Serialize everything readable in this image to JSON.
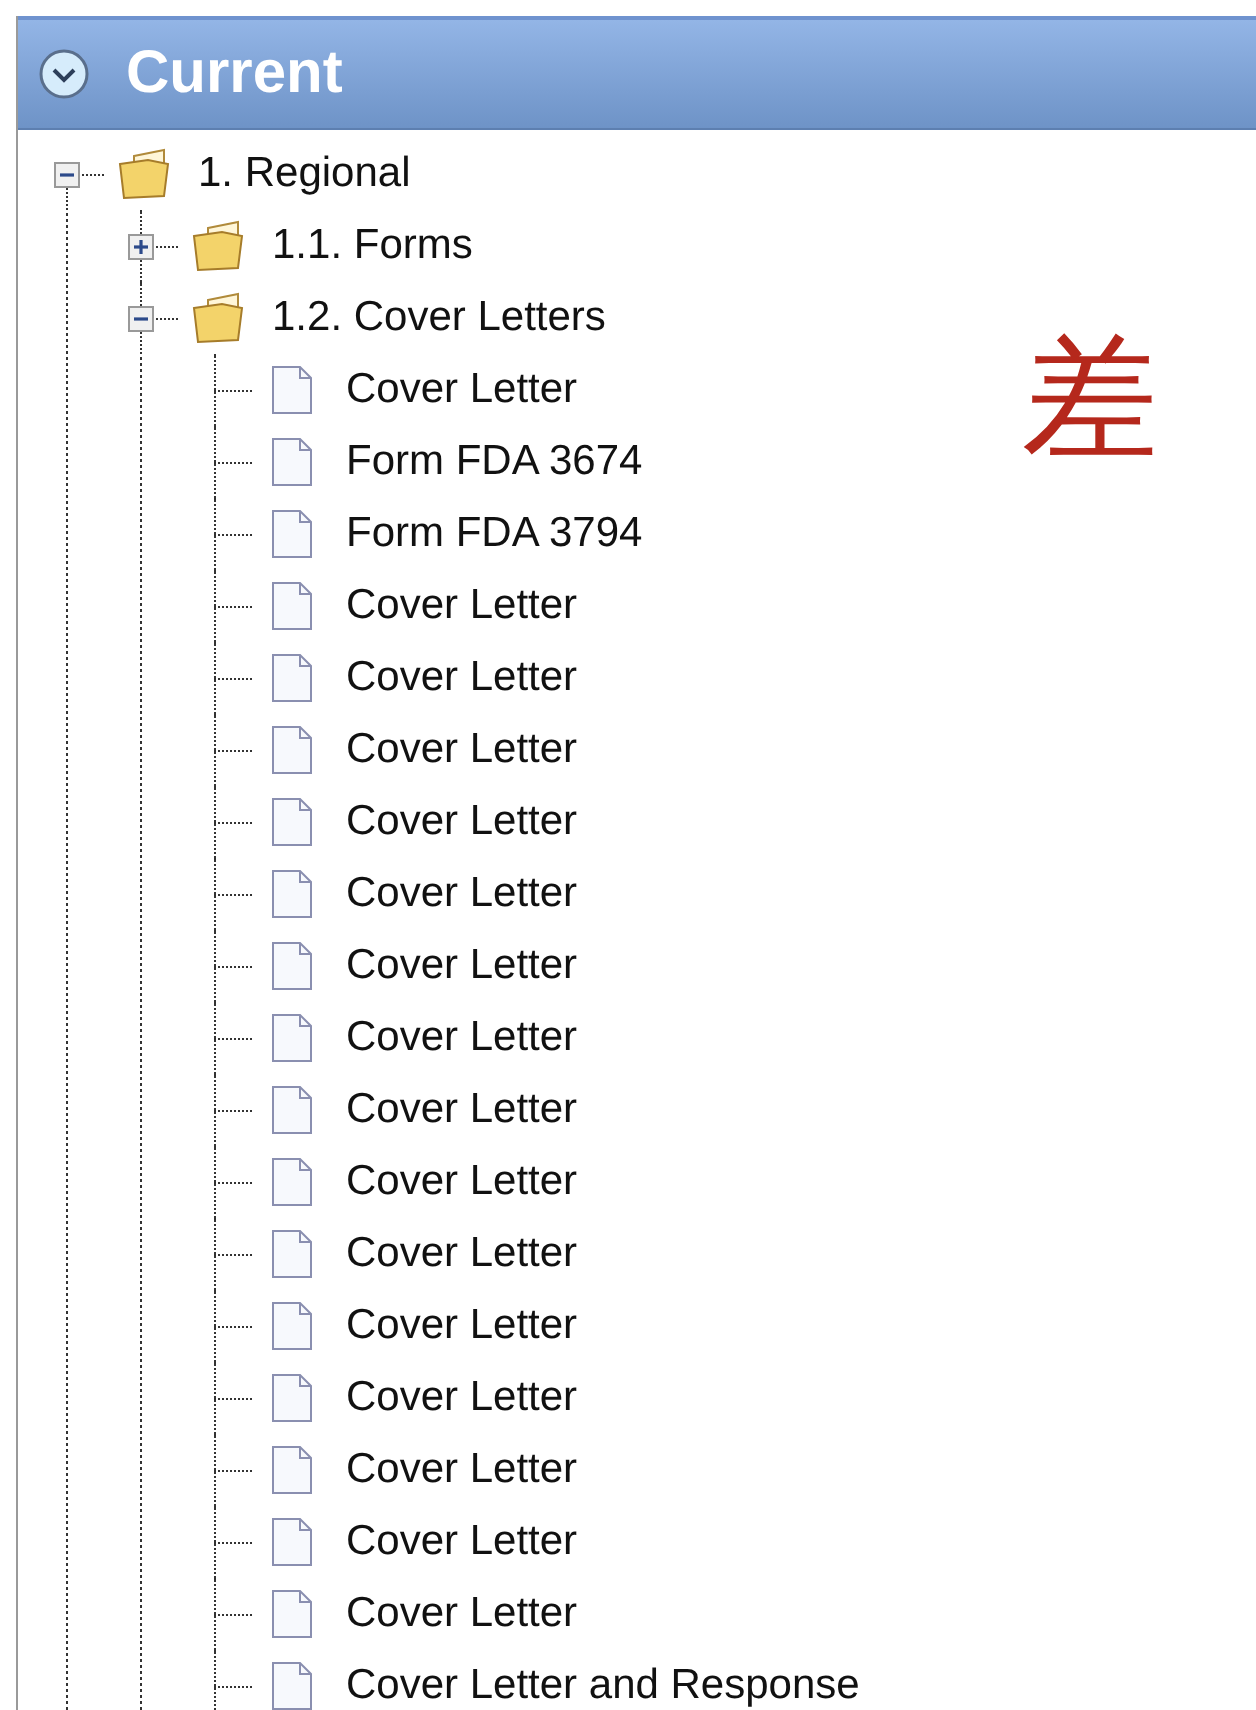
{
  "panel": {
    "title": "Current"
  },
  "tree": [
    {
      "kind": "folder",
      "label": "1. Regional",
      "expanded": true,
      "children": [
        {
          "kind": "folder",
          "label": "1.1. Forms",
          "expanded": false
        },
        {
          "kind": "folder",
          "label": "1.2. Cover Letters",
          "expanded": true,
          "children": [
            {
              "kind": "document",
              "label": "Cover Letter"
            },
            {
              "kind": "document",
              "label": "Form FDA 3674"
            },
            {
              "kind": "document",
              "label": "Form FDA 3794"
            },
            {
              "kind": "document",
              "label": "Cover Letter"
            },
            {
              "kind": "document",
              "label": "Cover Letter"
            },
            {
              "kind": "document",
              "label": "Cover Letter"
            },
            {
              "kind": "document",
              "label": "Cover Letter"
            },
            {
              "kind": "document",
              "label": "Cover Letter"
            },
            {
              "kind": "document",
              "label": "Cover Letter"
            },
            {
              "kind": "document",
              "label": "Cover Letter"
            },
            {
              "kind": "document",
              "label": "Cover Letter"
            },
            {
              "kind": "document",
              "label": "Cover Letter"
            },
            {
              "kind": "document",
              "label": "Cover Letter"
            },
            {
              "kind": "document",
              "label": "Cover Letter"
            },
            {
              "kind": "document",
              "label": "Cover Letter"
            },
            {
              "kind": "document",
              "label": "Cover Letter"
            },
            {
              "kind": "document",
              "label": "Cover Letter"
            },
            {
              "kind": "document",
              "label": "Cover Letter"
            },
            {
              "kind": "document",
              "label": "Cover Letter and Response"
            }
          ]
        }
      ]
    }
  ],
  "annotation": "差"
}
